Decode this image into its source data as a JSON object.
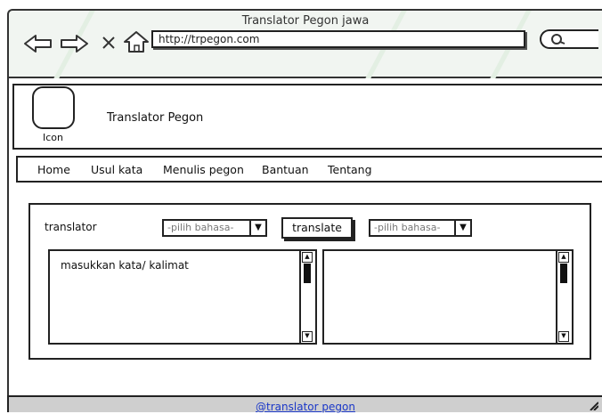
{
  "window": {
    "title": "Translator Pegon jawa"
  },
  "browser": {
    "url": "http://trpegon.com",
    "icons": [
      "back-arrow-icon",
      "forward-arrow-icon",
      "close-x-icon",
      "home-icon",
      "search-icon"
    ]
  },
  "header": {
    "logo_label": "Icon",
    "site_title": "Translator Pegon"
  },
  "menu": {
    "items": [
      "Home",
      "Usul kata",
      "Menulis pegon",
      "Bantuan",
      "Tentang"
    ]
  },
  "translator": {
    "label": "translator",
    "source_select": "-pilih bahasa-",
    "target_select": "-pilih bahasa-",
    "button": "translate",
    "input_value": "masukkan kata/ kalimat",
    "output_value": ""
  },
  "footer": {
    "link": "@translator pegon"
  }
}
